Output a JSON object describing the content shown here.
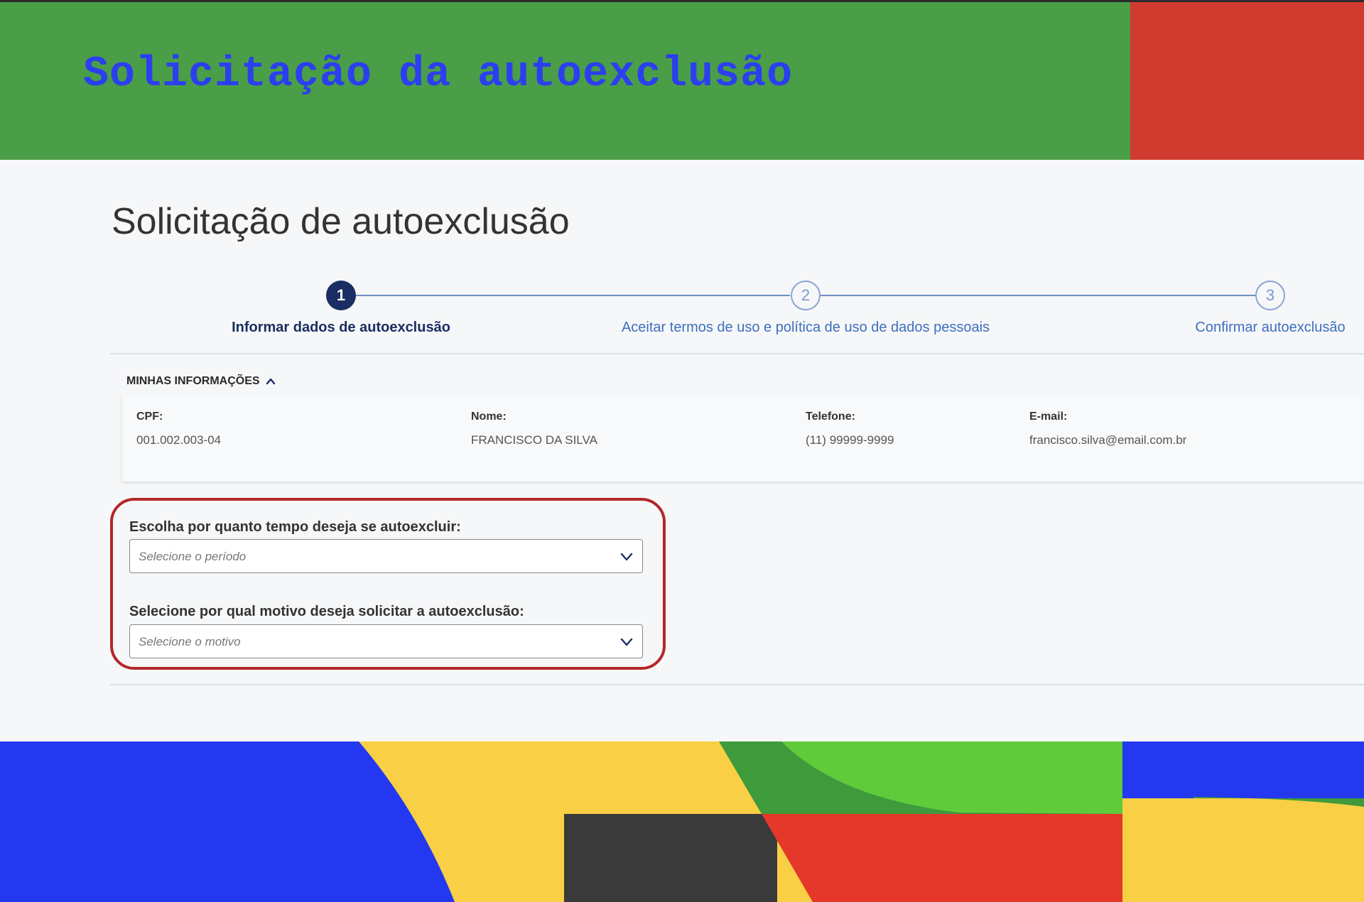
{
  "banner": {
    "title": "Solicitação da autoexclusão",
    "title_color": "#2b3ff0",
    "green": "#4a9e48",
    "red": "#d13a2e"
  },
  "page": {
    "title": "Solicitação de autoexclusão"
  },
  "stepper": {
    "steps": [
      {
        "number": "1",
        "label": "Informar dados de autoexclusão",
        "state": "active"
      },
      {
        "number": "2",
        "label": "Aceitar termos de uso e política de uso de dados pessoais",
        "state": "pending"
      },
      {
        "number": "3",
        "label": "Confirmar autoexclusão",
        "state": "pending"
      }
    ]
  },
  "info": {
    "section_title": "MINHAS INFORMAÇÕES",
    "toggle_icon": "chevron-up-icon",
    "fields": {
      "cpf": {
        "label": "CPF:",
        "value": "001.002.003-04"
      },
      "nome": {
        "label": "Nome:",
        "value": "FRANCISCO DA SILVA"
      },
      "telefone": {
        "label": "Telefone:",
        "value": "(11) 99999-9999"
      },
      "email": {
        "label": "E-mail:",
        "value": "francisco.silva@email.com.br"
      }
    }
  },
  "form": {
    "period": {
      "label": "Escolha por quanto tempo deseja se autoexcluir:",
      "placeholder": "Selecione o período"
    },
    "reason": {
      "label": "Selecione por qual motivo deseja solicitar a autoexclusão:",
      "placeholder": "Selecione o motivo"
    },
    "highlight_color": "#b3272a"
  },
  "colors": {
    "accent_blue": "#1a2e63",
    "footer_blue": "#2338f0",
    "footer_yellow": "#f8cf45",
    "footer_green_dark": "#3f9a3c",
    "footer_green_light": "#5fcb3a",
    "footer_red": "#e5372a",
    "footer_dark": "#3a3a3a"
  }
}
